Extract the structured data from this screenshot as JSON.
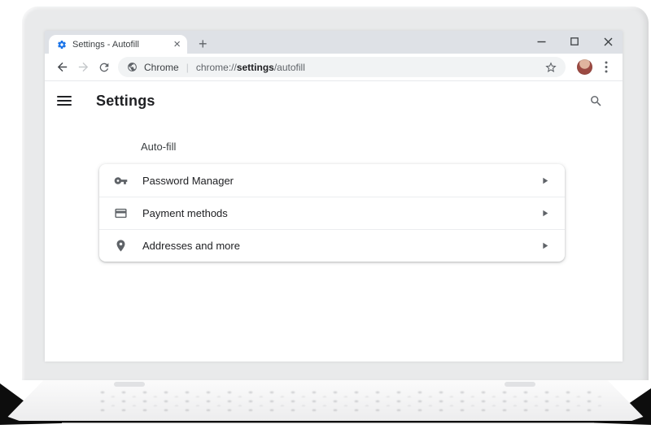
{
  "browser": {
    "tab": {
      "title": "Settings - Autofill",
      "favicon": "settings-gear-icon",
      "close_glyph": "×"
    },
    "new_tab_glyph": "+",
    "window_controls": {
      "minimize": "minimize-icon",
      "maximize": "maximize-icon",
      "close": "close-icon"
    },
    "toolbar": {
      "back": "back-arrow-icon",
      "forward": "forward-arrow-icon",
      "reload": "reload-icon",
      "omnibox": {
        "page_icon": "globe-icon",
        "site_label": "Chrome",
        "separator": "|",
        "url": {
          "scheme": "chrome://",
          "host": "settings",
          "path": "/autofill"
        },
        "bookmark": "star-icon"
      },
      "profile": "avatar",
      "menu": "three-dot-menu-icon"
    }
  },
  "settings": {
    "menu_icon": "hamburger-icon",
    "title": "Settings",
    "search_icon": "search-icon",
    "section_label": "Auto-fill",
    "items": [
      {
        "icon": "key-icon",
        "label": "Password Manager",
        "chevron": "right-arrow-icon"
      },
      {
        "icon": "credit-card-icon",
        "label": "Payment methods",
        "chevron": "right-arrow-icon"
      },
      {
        "icon": "location-pin-icon",
        "label": "Addresses and more",
        "chevron": "right-arrow-icon"
      }
    ]
  },
  "colors": {
    "accent_blue": "#1a73e8",
    "tab_strip": "#dee1e6",
    "icon_gray": "#5f6368",
    "text_primary": "#202124",
    "omnibox_bg": "#f1f3f4"
  }
}
